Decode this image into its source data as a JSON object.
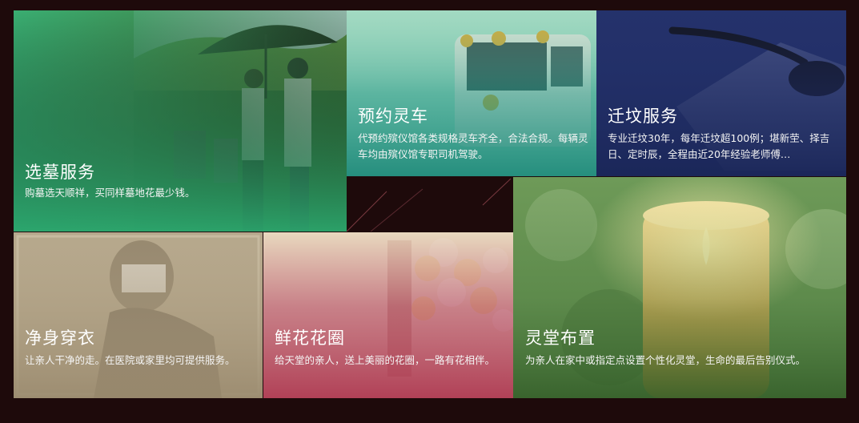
{
  "services": [
    {
      "title": "选墓服务",
      "desc": "购墓选天顺祥，买同样墓地花最少钱。"
    },
    {
      "title": "预约灵车",
      "desc": "代预约殡仪馆各类规格灵车齐全，合法合规。每辆灵车均由殡仪馆专职司机驾驶。"
    },
    {
      "title": "迁坟服务",
      "desc": "专业迁坟30年，每年迁坟超100例；堪新茔、择吉日、定时辰，全程由近20年经验老师傅…"
    },
    {
      "title": "净身穿衣",
      "desc": "让亲人干净的走。在医院或家里均可提供服务。"
    },
    {
      "title": "鲜花花圈",
      "desc": "给天堂的亲人，送上美丽的花圈，一路有花相伴。"
    },
    {
      "title": "灵堂布置",
      "desc": "为亲人在家中或指定点设置个性化灵堂，生命的最后告别仪式。"
    }
  ]
}
